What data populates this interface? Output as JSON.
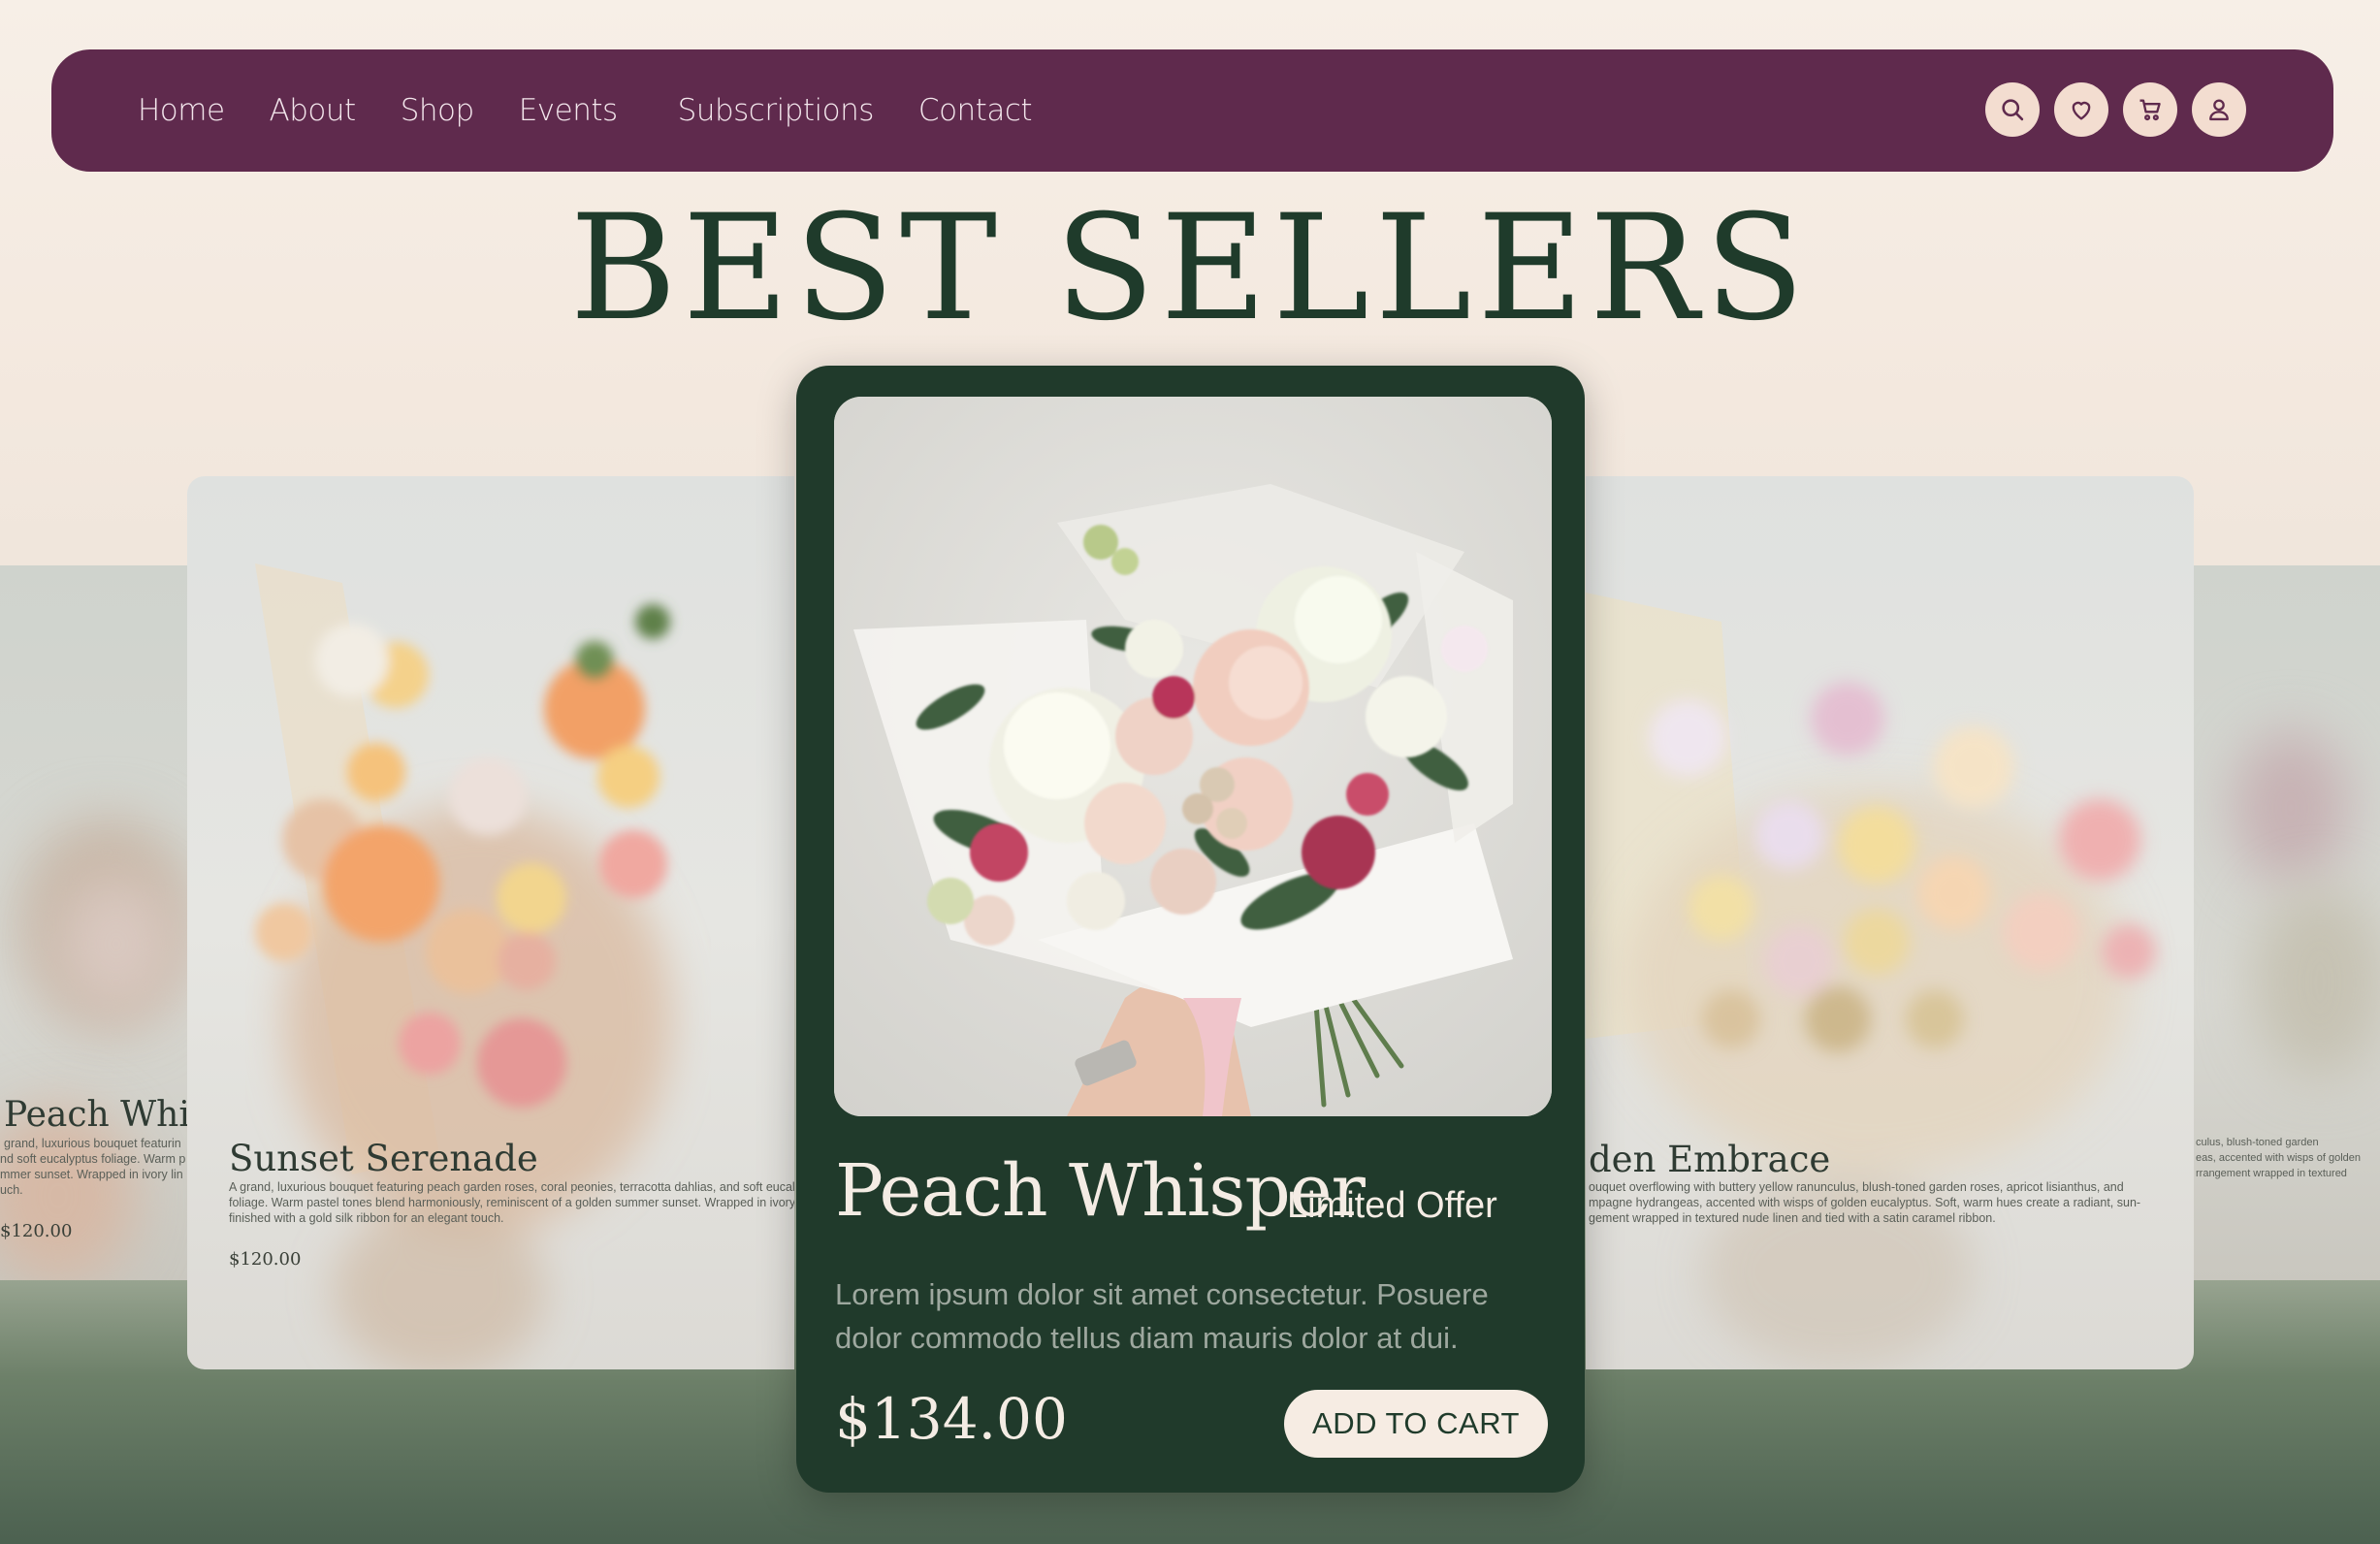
{
  "nav": {
    "links": [
      "Home",
      "About",
      "Shop",
      "Events",
      "Subscriptions",
      "Contact"
    ],
    "icons": [
      "search-icon",
      "heart-icon",
      "cart-icon",
      "user-icon"
    ]
  },
  "page_title": "BEST SELLERS",
  "featured": {
    "name": "Peach Whisper",
    "badge": "Limited Offer",
    "description": "Lorem ipsum dolor sit amet consectetur. Posuere dolor commodo tellus diam mauris dolor at dui.",
    "price": "$134.00",
    "cta": "ADD TO CART"
  },
  "cards": {
    "far_left": {
      "name": "Peach Whisp",
      "desc1": "grand, luxurious bouquet featurin",
      "desc2": "nd soft eucalyptus foliage. Warm p",
      "desc3": "mmer sunset. Wrapped in ivory lin",
      "desc4": "uch.",
      "price": "$120.00"
    },
    "left": {
      "name": "Sunset Serenade",
      "desc1": "A grand, luxurious bouquet featuring peach garden roses, coral peonies, terracotta dahlias, and soft eucal",
      "desc2": "foliage. Warm pastel tones blend harmoniously, reminiscent of a golden summer sunset. Wrapped in ivory l",
      "desc3": "finished with a gold silk ribbon for an elegant touch.",
      "price": "$120.00"
    },
    "right": {
      "name": "den Embrace",
      "desc1": "ouquet overflowing with buttery yellow ranunculus, blush-toned garden roses, apricot lisianthus, and",
      "desc2": "mpagne hydrangeas, accented with wisps of golden eucalyptus. Soft, warm hues create a radiant, sun-",
      "desc3": "gement wrapped in textured nude linen and tied with a satin caramel ribbon."
    },
    "far_right": {
      "desc1": "culus, blush-toned garden",
      "desc2": "eas, accented with wisps of golden",
      "desc3": "rrangement wrapped in textured"
    }
  }
}
